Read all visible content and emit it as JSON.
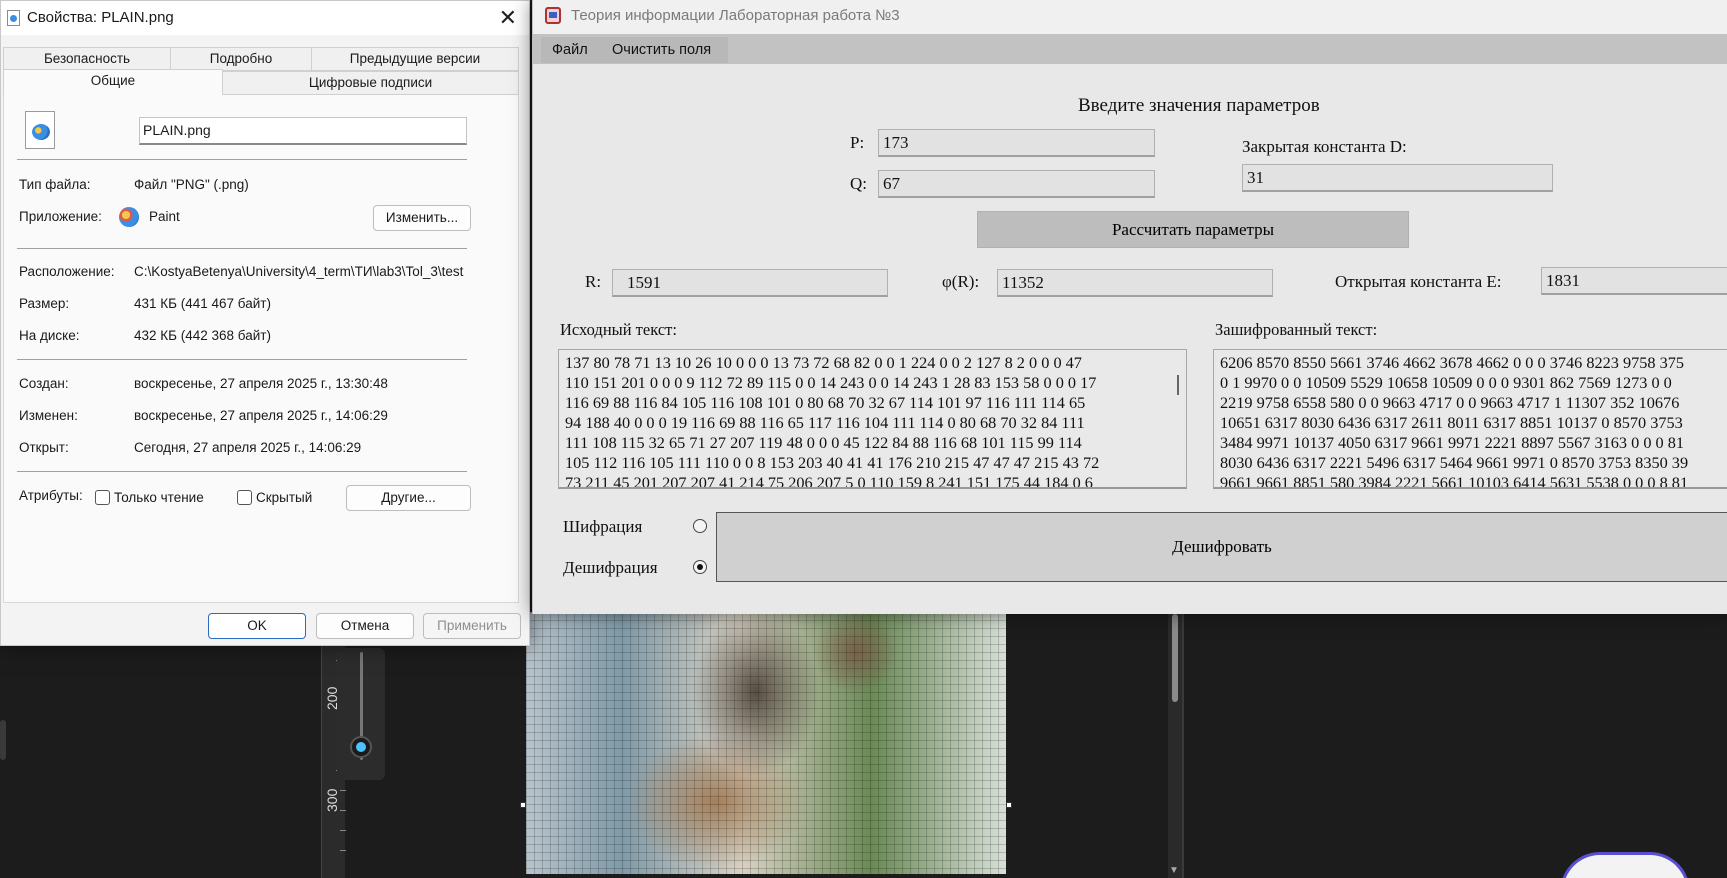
{
  "editor": {
    "ruler_labels": [
      "200",
      "300"
    ]
  },
  "properties_dialog": {
    "title": "Свойства: PLAIN.png",
    "tabs_top": [
      "Безопасность",
      "Подробно",
      "Предыдущие версии"
    ],
    "tabs_bottom": [
      "Общие",
      "Цифровые подписи"
    ],
    "file_name": "PLAIN.png",
    "file_type_label": "Тип файла:",
    "file_type_value": "Файл \"PNG\" (.png)",
    "app_label": "Приложение:",
    "app_value": "Paint",
    "change_button": "Изменить...",
    "location_label": "Расположение:",
    "location_value": "C:\\KostyaBetenya\\University\\4_term\\ТИ\\lab3\\Tol_3\\test",
    "size_label": "Размер:",
    "size_value": "431 КБ (441 467 байт)",
    "disk_label": "На диске:",
    "disk_value": "432 КБ (442 368 байт)",
    "created_label": "Создан:",
    "created_value": "воскресенье, 27 апреля 2025 г., 13:30:48",
    "modified_label": "Изменен:",
    "modified_value": "воскресенье, 27 апреля 2025 г., 14:06:29",
    "opened_label": "Открыт:",
    "opened_value": "Сегодня, 27 апреля 2025 г., 14:06:29",
    "attributes_label": "Атрибуты:",
    "readonly_label": "Только чтение",
    "hidden_label": "Скрытый",
    "other_button": "Другие...",
    "ok_button": "OK",
    "cancel_button": "Отмена",
    "apply_button": "Применить"
  },
  "app": {
    "title": "Теория информации Лабораторная работа №3",
    "menu": [
      "Файл",
      "Очистить поля"
    ],
    "heading": "Введите значения параметров",
    "p_label": "P:",
    "p_value": "173",
    "q_label": "Q:",
    "q_value": "67",
    "d_label": "Закрытая константа D:",
    "d_value": "31",
    "calc_button": "Рассчитать параметры",
    "r_label": "R:",
    "r_value": "1591",
    "phi_label": "φ(R):",
    "phi_value": "11352",
    "e_label": "Открытая константа E:",
    "e_value": "1831",
    "source_label": "Исходный текст:",
    "source_lines": [
      "137 80 78 71 13 10 26 10 0 0 0 13 73 72 68 82 0 0 1 224 0 0 2 127 8 2 0 0 0 47",
      "110 151 201 0 0 0 9 112 72 89 115 0 0 14 243 0 0 14 243 1 28 83 153 58 0 0 0 17",
      "116 69 88 116 84 105 116 108 101 0 80 68 70 32 67 114 101 97 116 111 114 65",
      "94 188 40 0 0 0 19 116 69 88 116 65 117 116 104 111 114 0 80 68 70 32 84 111",
      "111 108 115 32 65 71 27 207 119 48 0 0 0 45 122 84 88 116 68 101 115 99 114",
      "105 112 116 105 111 110 0 0 8 153 203 40 41 41 176 210 215 47 47 47 215 43 72",
      "73 211 45 201 207 207 41 214 75 206 207 5 0 110 159 8 241 151 175 44 184 0 6"
    ],
    "cipher_label": "Зашифрованный текст:",
    "cipher_lines": [
      "6206 8570 8550 5661 3746 4662 3678 4662 0 0 0 3746 8223 9758 375",
      "0 1 9970 0 0 10509 5529 10658 10509 0 0 0 9301 862 7569 1273 0 0",
      "2219 9758 6558 580 0 0 9663 4717 0 0 9663 4717 1 11307 352 10676",
      "10651 6317 8030 6436 6317 2611 8011 6317 8851 10137 0 8570 3753",
      "3484 9971 10137 4050 6317 9661 9971 2221 8897 5567 3163 0 0 0 81",
      "8030 6436 6317 2221 5496 6317 5464 9661 9971 0 8570 3753 8350 39",
      "9661 9661 8851 580 3984 2221 5661 10103 6414 5631 5538 0 0 0 8 81"
    ],
    "mode_encrypt": "Шифрация",
    "mode_decrypt": "Дешифрация",
    "selected_mode": "Дешифрация",
    "action_button": "Дешифровать"
  }
}
